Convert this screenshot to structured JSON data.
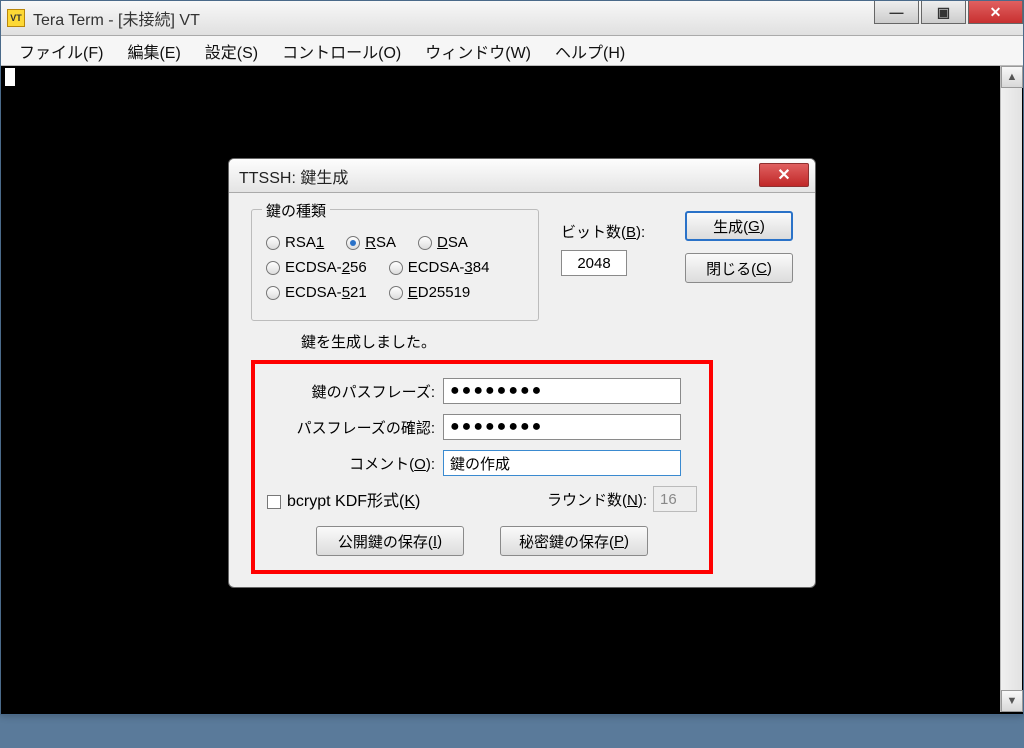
{
  "mainWindow": {
    "title": "Tera Term - [未接続] VT",
    "appIcon": "VT",
    "menu": {
      "file": "ファイル(F)",
      "edit": "編集(E)",
      "setup": "設定(S)",
      "control": "コントロール(O)",
      "window": "ウィンドウ(W)",
      "help": "ヘルプ(H)"
    },
    "minimize": "—",
    "maximize": "▣",
    "close": "✕"
  },
  "dialog": {
    "title": "TTSSH: 鍵生成",
    "close": "✕",
    "keyTypeGroup": "鍵の種類",
    "radios": {
      "rsa1": "RSA1",
      "rsa": "RSA",
      "dsa": "DSA",
      "ecdsa256": "ECDSA-256",
      "ecdsa384": "ECDSA-384",
      "ecdsa521": "ECDSA-521",
      "ed25519": "ED25519"
    },
    "bitsLabel": "ビット数(B):",
    "bitsValue": "2048",
    "generateBtn": "生成(G)",
    "closeBtn": "閉じる(C)",
    "status": "鍵を生成しました。",
    "passLabel": "鍵のパスフレーズ:",
    "passConfirmLabel": "パスフレーズの確認:",
    "passValue": "●●●●●●●●",
    "passConfirmValue": "●●●●●●●●",
    "commentLabel": "コメント(O):",
    "commentValue": "鍵の作成",
    "bcryptLabel": "bcrypt KDF形式(K)",
    "roundsLabel": "ラウンド数(N):",
    "roundsValue": "16",
    "savePubBtn": "公開鍵の保存(I)",
    "savePrivBtn": "秘密鍵の保存(P)"
  }
}
